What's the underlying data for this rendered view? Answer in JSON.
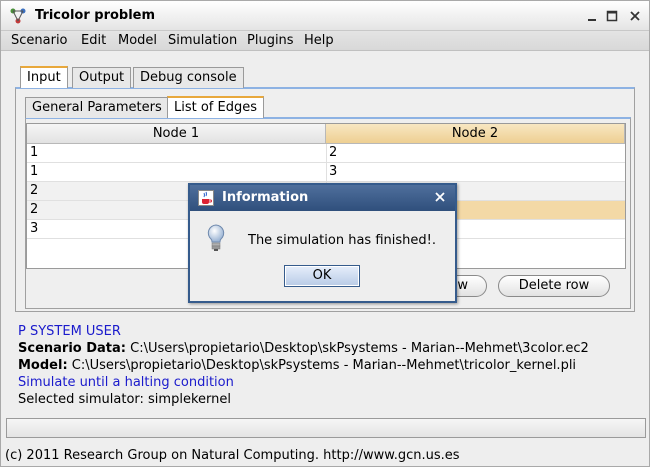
{
  "window": {
    "title": "Tricolor problem"
  },
  "menu": [
    "Scenario",
    "Edit",
    "Model",
    "Simulation",
    "Plugins",
    "Help"
  ],
  "outer_tabs": [
    "Input",
    "Output",
    "Debug console"
  ],
  "inner_tabs": [
    "General Parameters",
    "List of Edges"
  ],
  "table": {
    "headers": [
      "Node 1",
      "Node 2"
    ],
    "rows": [
      [
        "1",
        "2"
      ],
      [
        "1",
        "3"
      ],
      [
        "2",
        ""
      ],
      [
        "2",
        ""
      ],
      [
        "3",
        ""
      ]
    ]
  },
  "buttons": {
    "add_row_partial": "w",
    "delete_row": "Delete row"
  },
  "info": {
    "system": "P SYSTEM USER",
    "scenario_label": "Scenario Data:",
    "scenario_value": " C:\\Users\\propietario\\Desktop\\skPsystems - Marian--Mehmet\\3color.ec2",
    "model_label": "Model:",
    "model_value": " C:\\Users\\propietario\\Desktop\\skPsystems - Marian--Mehmet\\tricolor_kernel.pli",
    "simulate": "Simulate until a halting condition",
    "selected_sim": "Selected simulator: simplekernel"
  },
  "footer": "(c) 2011 Research Group on Natural Computing. http://www.gcn.us.es",
  "dialog": {
    "title": "Information",
    "message": "The simulation has finished!.",
    "ok": "OK"
  },
  "colors": {
    "accent_tab": "#e8a83c",
    "dialog_title": "#355b8c",
    "blue_text": "#1a1acc",
    "selected_header": "#eecf92"
  }
}
